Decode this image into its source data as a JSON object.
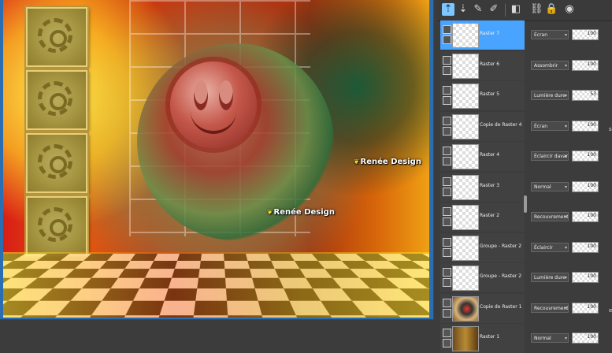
{
  "canvas": {
    "watermarks": [
      "Renée Design",
      "Renée Design"
    ]
  },
  "toolbar": {
    "icons": [
      "new-raster-layer-icon",
      "new-vector-layer-icon",
      "paint-icon",
      "brush-icon",
      "mask-icon",
      "link-icon",
      "lock-icon",
      "add-icon"
    ]
  },
  "layers": [
    {
      "name": "Raster 7",
      "blend": "Écran",
      "opacity": "100",
      "selected": true,
      "thumb": "checker"
    },
    {
      "name": "Raster 6",
      "blend": "Assombrir",
      "opacity": "100",
      "selected": false,
      "thumb": "checker"
    },
    {
      "name": "Raster 5",
      "blend": "Lumière dure",
      "opacity": "53",
      "selected": false,
      "thumb": "checker"
    },
    {
      "name": "Copie de Raster 4",
      "blend": "Écran",
      "opacity": "100",
      "selected": false,
      "thumb": "checker"
    },
    {
      "name": "Raster 4",
      "blend": "Éclaircir davantage",
      "opacity": "100",
      "selected": false,
      "thumb": "checker"
    },
    {
      "name": "Raster 3",
      "blend": "Normal",
      "opacity": "100",
      "selected": false,
      "thumb": "checker"
    },
    {
      "name": "Raster 2",
      "blend": "Recouvrement",
      "opacity": "100",
      "selected": false,
      "thumb": "checker"
    },
    {
      "name": "Groupe - Raster 2",
      "blend": "Éclaircir",
      "opacity": "100",
      "selected": false,
      "thumb": "checker"
    },
    {
      "name": "Groupe - Raster 2",
      "blend": "Lumière dure",
      "opacity": "100",
      "selected": false,
      "thumb": "checker"
    },
    {
      "name": "Copie de Raster 1",
      "blend": "Recouvrement",
      "opacity": "100",
      "selected": false,
      "thumb": "img"
    },
    {
      "name": "Raster 1",
      "blend": "Normal",
      "opacity": "100",
      "selected": false,
      "thumb": "brown"
    }
  ]
}
